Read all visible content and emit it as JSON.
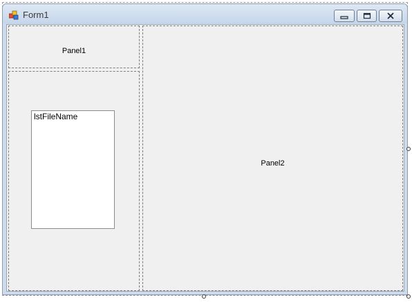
{
  "window": {
    "title": "Form1",
    "icon": "form-icon"
  },
  "caption_buttons": [
    {
      "name": "minimize",
      "icon": "minimize-icon"
    },
    {
      "name": "maximize",
      "icon": "maximize-icon"
    },
    {
      "name": "close",
      "icon": "close-icon"
    }
  ],
  "panels": {
    "panel1": {
      "label": "Panel1"
    },
    "panel2": {
      "label": "Panel2"
    }
  },
  "listbox": {
    "label": "lstFileName"
  },
  "colors": {
    "titlebar": "#cddbeb",
    "client_background": "#f0f0f0",
    "listbox_background": "#ffffff"
  }
}
